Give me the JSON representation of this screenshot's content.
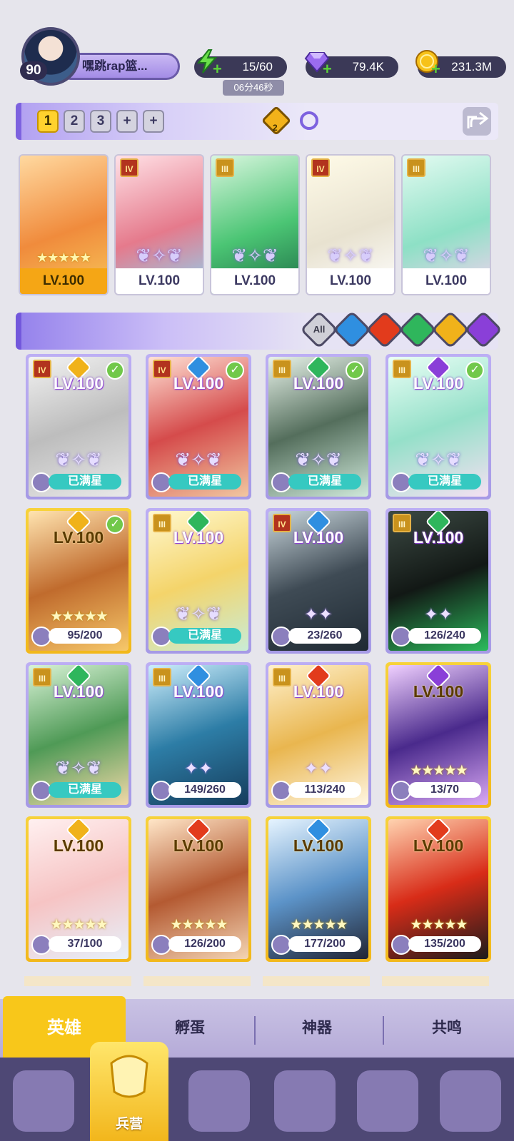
{
  "player": {
    "level": "90",
    "name": "嘿跳rap篮..."
  },
  "resources": {
    "energy": "15/60",
    "energy_timer": "06分46秒",
    "gems": "79.4K",
    "gold": "231.3M"
  },
  "team": {
    "tabs": [
      "1",
      "2",
      "3",
      "+",
      "+"
    ],
    "selected_tab": "1",
    "badge_count": "2",
    "heroes": [
      {
        "rank": "",
        "stars": "★★★★★",
        "level": "LV.100",
        "element": "light",
        "gold": true
      },
      {
        "rank": "IV",
        "stars": "",
        "level": "LV.100",
        "element": "water",
        "gold": false
      },
      {
        "rank": "III",
        "stars": "",
        "level": "LV.100",
        "element": "wind",
        "gold": false
      },
      {
        "rank": "IV",
        "stars": "",
        "level": "LV.100",
        "element": "light",
        "gold": false
      },
      {
        "rank": "III",
        "stars": "",
        "level": "LV.100",
        "element": "dark",
        "gold": false
      }
    ]
  },
  "filters": {
    "all_label": "All",
    "elements": [
      "water",
      "fire",
      "wind",
      "light",
      "dark"
    ]
  },
  "hero_cards": [
    {
      "rank": "IV",
      "element": "light",
      "level": "LV.100",
      "progress": "已满星",
      "full": true,
      "checked": true
    },
    {
      "rank": "IV",
      "element": "water",
      "level": "LV.100",
      "progress": "已满星",
      "full": true,
      "checked": true
    },
    {
      "rank": "III",
      "element": "wind",
      "level": "LV.100",
      "progress": "已满星",
      "full": true,
      "checked": true
    },
    {
      "rank": "III",
      "element": "dark",
      "level": "LV.100",
      "progress": "已满星",
      "full": true,
      "checked": true
    },
    {
      "rank": "",
      "element": "light",
      "level": "LV.100",
      "progress": "95/200",
      "full": false,
      "checked": true
    },
    {
      "rank": "III",
      "element": "wind",
      "level": "LV.100",
      "progress": "已满星",
      "full": true,
      "checked": false
    },
    {
      "rank": "IV",
      "element": "water",
      "level": "LV.100",
      "progress": "23/260",
      "full": false,
      "checked": false
    },
    {
      "rank": "III",
      "element": "wind",
      "level": "LV.100",
      "progress": "126/240",
      "full": false,
      "checked": false
    },
    {
      "rank": "III",
      "element": "wind",
      "level": "LV.100",
      "progress": "已满星",
      "full": true,
      "checked": false
    },
    {
      "rank": "III",
      "element": "water",
      "level": "LV.100",
      "progress": "149/260",
      "full": false,
      "checked": false
    },
    {
      "rank": "III",
      "element": "fire",
      "level": "LV.100",
      "progress": "113/240",
      "full": false,
      "checked": false
    },
    {
      "rank": "",
      "element": "dark",
      "level": "LV.100",
      "progress": "13/70",
      "full": false,
      "checked": false
    },
    {
      "rank": "",
      "element": "light",
      "level": "LV.100",
      "progress": "37/100",
      "full": false,
      "checked": false
    },
    {
      "rank": "",
      "element": "fire",
      "level": "LV.100",
      "progress": "126/200",
      "full": false,
      "checked": false
    },
    {
      "rank": "",
      "element": "water",
      "level": "LV.100",
      "progress": "177/200",
      "full": false,
      "checked": false
    },
    {
      "rank": "",
      "element": "fire",
      "level": "LV.100",
      "progress": "135/200",
      "full": false,
      "checked": false
    }
  ],
  "tabs": {
    "heroes": "英雄",
    "hatch": "孵蛋",
    "artifact": "神器",
    "resonance": "共鸣"
  },
  "nav": {
    "active_label": "兵营"
  },
  "colors": {
    "water": "#2f8fe0",
    "fire": "#e23b1c",
    "wind": "#2fb65c",
    "light": "#f0b21a",
    "dark": "#8a3fd8",
    "accent": "#7d62df",
    "gold": "#f8c71a"
  }
}
